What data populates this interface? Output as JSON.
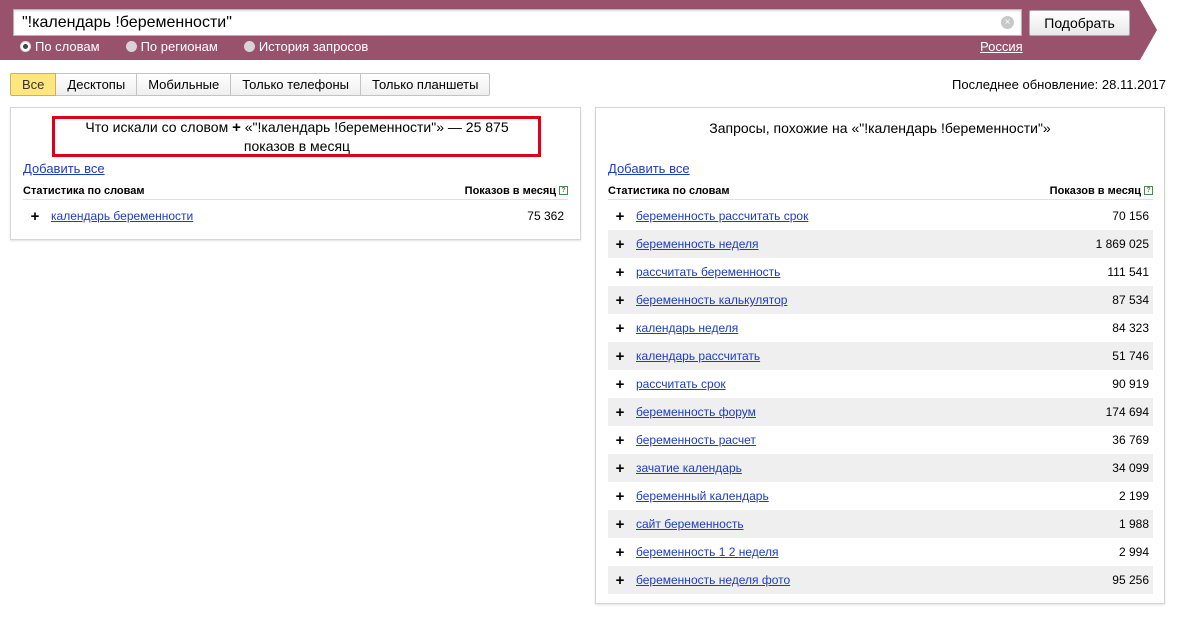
{
  "search": {
    "query": "\"!календарь !беременности\"",
    "clear_glyph": "×",
    "submit_label": "Подобрать"
  },
  "modes": [
    {
      "label": "По словам",
      "checked": true
    },
    {
      "label": "По регионам",
      "checked": false
    },
    {
      "label": "История запросов",
      "checked": false
    }
  ],
  "region": "Россия",
  "tabs": [
    {
      "label": "Все",
      "active": true
    },
    {
      "label": "Десктопы",
      "active": false
    },
    {
      "label": "Мобильные",
      "active": false
    },
    {
      "label": "Только телефоны",
      "active": false
    },
    {
      "label": "Только планшеты",
      "active": false
    }
  ],
  "last_update": "Последнее обновление: 28.11.2017",
  "left_panel": {
    "title_prefix": "Что искали со словом",
    "plus": "+",
    "title_suffix_line1": "«\"!календарь !беременности\"» — 25 875",
    "title_line2": "показов в месяц",
    "add_all": "Добавить все",
    "col_words": "Статистика по словам",
    "col_shows": "Показов в месяц",
    "help": "?",
    "rows": [
      {
        "phrase": "календарь беременности",
        "count": "75 362"
      }
    ]
  },
  "right_panel": {
    "title": "Запросы, похожие на «\"!календарь !беременности\"»",
    "add_all": "Добавить все",
    "col_words": "Статистика по словам",
    "col_shows": "Показов в месяц",
    "help": "?",
    "rows": [
      {
        "phrase": "беременность рассчитать срок",
        "count": "70 156"
      },
      {
        "phrase": "беременность неделя",
        "count": "1 869 025"
      },
      {
        "phrase": "рассчитать беременность",
        "count": "111 541"
      },
      {
        "phrase": "беременность калькулятор",
        "count": "87 534"
      },
      {
        "phrase": "календарь неделя",
        "count": "84 323"
      },
      {
        "phrase": "календарь рассчитать",
        "count": "51 746"
      },
      {
        "phrase": "рассчитать срок",
        "count": "90 919"
      },
      {
        "phrase": "беременность форум",
        "count": "174 694"
      },
      {
        "phrase": "беременность расчет",
        "count": "36 769"
      },
      {
        "phrase": "зачатие календарь",
        "count": "34 099"
      },
      {
        "phrase": "беременный календарь",
        "count": "2 199"
      },
      {
        "phrase": "сайт беременность",
        "count": "1 988"
      },
      {
        "phrase": "беременность 1 2 неделя",
        "count": "2 994"
      },
      {
        "phrase": "беременность неделя фото",
        "count": "95 256"
      }
    ]
  },
  "colors": {
    "header_band": "#98526b",
    "link": "#1a3dc1",
    "active_tab": "#ffe67e",
    "highlight": "#e0001a"
  }
}
